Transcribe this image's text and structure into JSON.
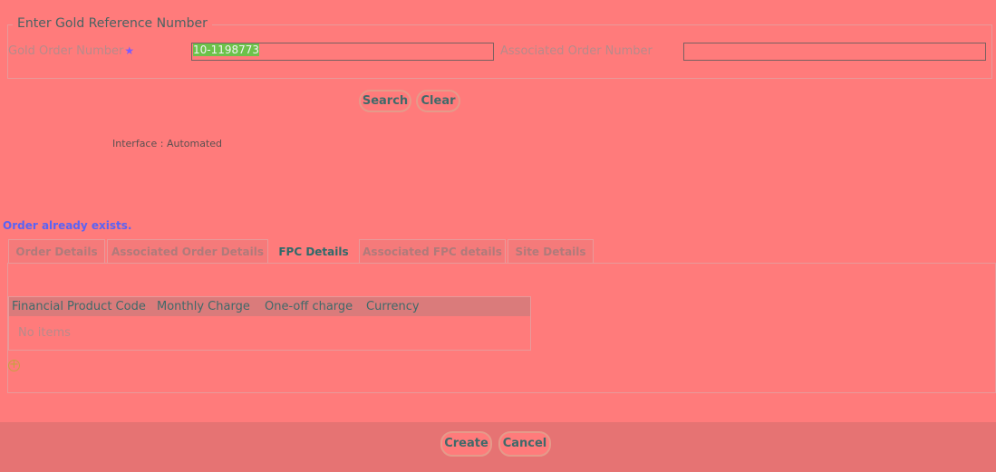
{
  "search_section": {
    "legend": "Enter Gold Reference Number",
    "gold_order_label": "Gold Order Number",
    "required_mark": "★",
    "gold_order_value": "10-1198773",
    "associated_order_label": "Associated Order Number",
    "associated_order_value": ""
  },
  "search_buttons": {
    "search_label": "Search",
    "clear_label": "Clear"
  },
  "interface_text": "Interface : Automated",
  "message": "Order already exists.",
  "tabs": [
    {
      "label": "Order Details",
      "active": false
    },
    {
      "label": "Associated Order Details",
      "active": false
    },
    {
      "label": "FPC Details",
      "active": true
    },
    {
      "label": "Associated FPC details",
      "active": false
    },
    {
      "label": "Site Details",
      "active": false
    }
  ],
  "fpc_grid": {
    "columns": [
      "Financial Product Code",
      "Monthly Charge",
      "One-off charge",
      "Currency"
    ],
    "empty_text": "No items",
    "add_icon": "plus-circle-icon"
  },
  "footer": {
    "create_label": "Create",
    "cancel_label": "Cancel"
  },
  "colors": {
    "background": "#ff7b7b",
    "message": "#5a63f5",
    "selection": "#6cc24a"
  }
}
